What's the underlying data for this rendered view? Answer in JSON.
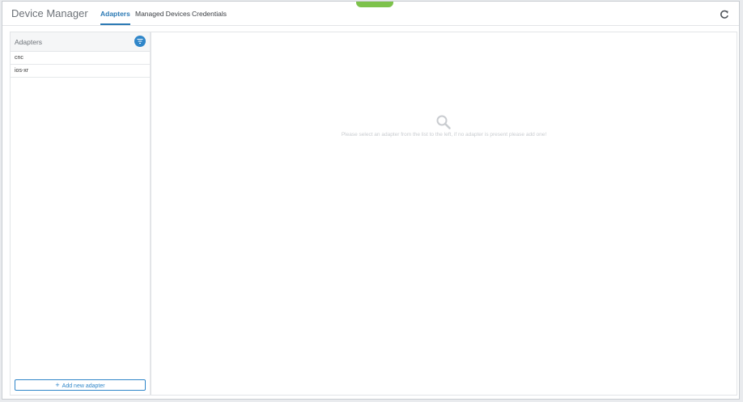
{
  "header": {
    "app_title": "Device Manager",
    "tabs": [
      {
        "label": "Adapters",
        "active": true
      },
      {
        "label": "Managed Devices",
        "active": false
      },
      {
        "label": "Credentials",
        "active": false
      }
    ],
    "refresh_icon": "refresh-icon"
  },
  "sidebar": {
    "title": "Adapters",
    "filter_icon": "filter-icon",
    "items": [
      {
        "label": "cnc"
      },
      {
        "label": "ios-xr"
      }
    ],
    "add_button_label": "Add new adapter"
  },
  "main": {
    "empty_icon": "search-icon",
    "empty_message": "Please select an adapter from the list to the left, if no adapter is present please add one!"
  },
  "colors": {
    "accent": "#2b79b4",
    "indicator": "#7dc24b"
  }
}
